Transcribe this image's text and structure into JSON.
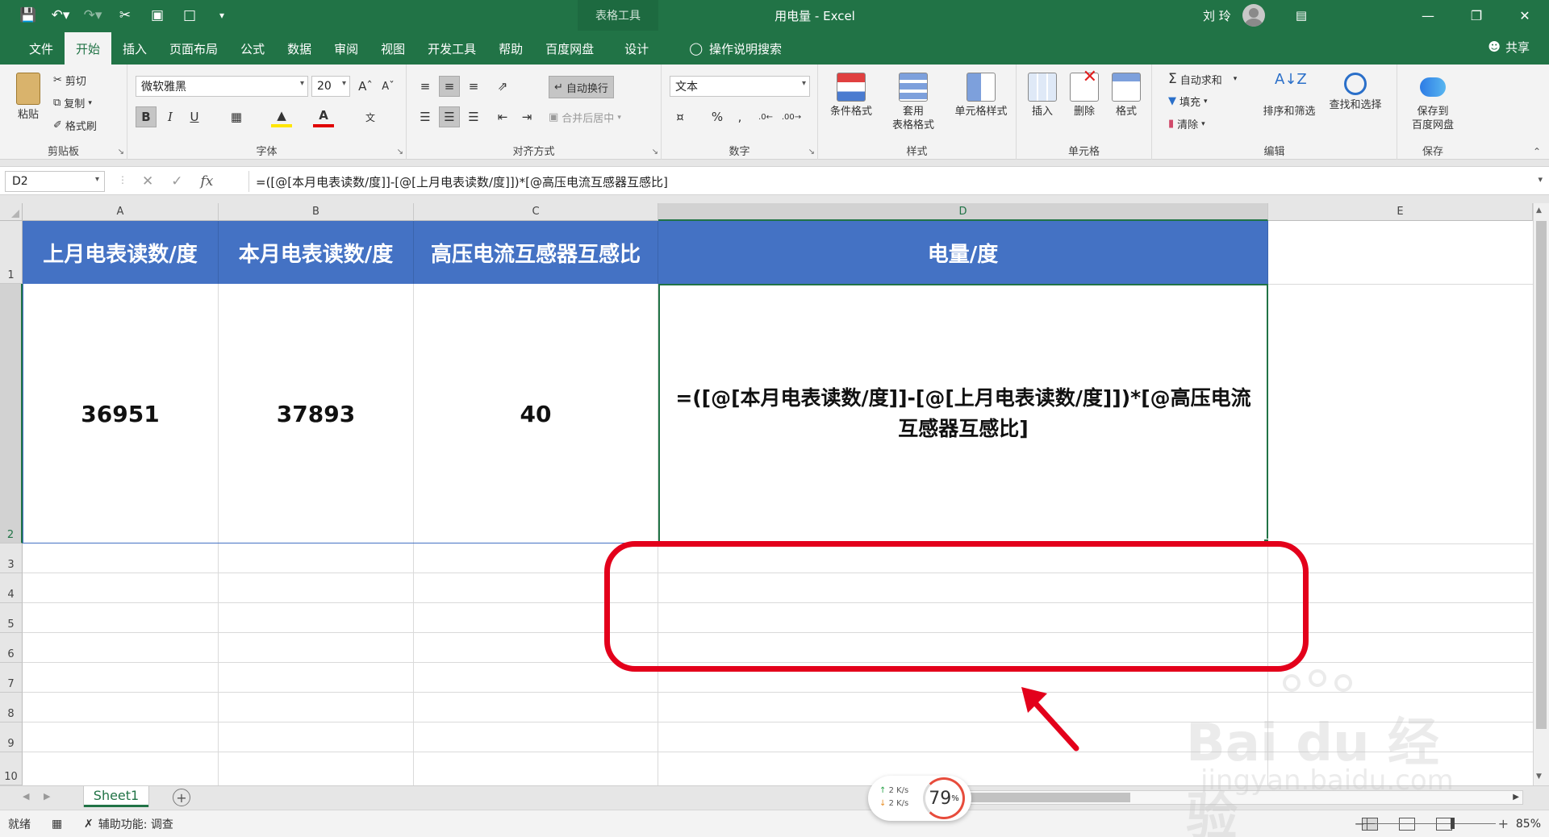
{
  "titlebar": {
    "context_tools": "表格工具",
    "doc_title": "用电量  -  Excel",
    "user_name": "刘 玲"
  },
  "tabs": [
    {
      "label": "文件"
    },
    {
      "label": "开始"
    },
    {
      "label": "插入"
    },
    {
      "label": "页面布局"
    },
    {
      "label": "公式"
    },
    {
      "label": "数据"
    },
    {
      "label": "审阅"
    },
    {
      "label": "视图"
    },
    {
      "label": "开发工具"
    },
    {
      "label": "帮助"
    },
    {
      "label": "百度网盘"
    },
    {
      "label": "设计"
    }
  ],
  "active_tab": "开始",
  "tell_me": "操作说明搜索",
  "share": "共享",
  "ribbon": {
    "clipboard": {
      "label": "剪贴板",
      "paste": "粘贴",
      "cut": "剪切",
      "copy": "复制",
      "format_painter": "格式刷"
    },
    "font": {
      "label": "字体",
      "font_name": "微软雅黑",
      "font_size": "20",
      "bold": "B",
      "italic": "I",
      "underline": "U"
    },
    "alignment": {
      "label": "对齐方式",
      "wrap_text": "自动换行",
      "merge_center": "合并后居中"
    },
    "number": {
      "label": "数字",
      "format": "文本",
      "percent": "%"
    },
    "styles": {
      "label": "样式",
      "conditional": "条件格式",
      "table_format_1": "套用",
      "table_format_2": "表格格式",
      "cell_styles": "单元格样式"
    },
    "cells": {
      "label": "单元格",
      "insert": "插入",
      "delete": "删除",
      "format": "格式"
    },
    "editing": {
      "label": "编辑",
      "autosum": "自动求和",
      "fill": "填充",
      "clear": "清除",
      "sort_filter": "排序和筛选",
      "find_select": "查找和选择"
    },
    "save": {
      "label": "保存",
      "save_to_1": "保存到",
      "save_to_2": "百度网盘"
    }
  },
  "formula_bar": {
    "name_box": "D2",
    "fx": "fx",
    "formula": "=([@[本月电表读数/度]]-[@[上月电表读数/度]])*[@高压电流互感器互感比]"
  },
  "columns": [
    "A",
    "B",
    "C",
    "D",
    "E"
  ],
  "rows": [
    "1",
    "2",
    "3",
    "4",
    "5",
    "6",
    "7",
    "8",
    "9",
    "10"
  ],
  "table": {
    "headers": [
      "上月电表读数/度",
      "本月电表读数/度",
      "高压电流互感器互感比",
      "电量/度"
    ],
    "row2": [
      "36951",
      "37893",
      "40",
      "=([@[本月电表读数/度]]-[@[上月电表读数/度]])*[@高压电流互感器互感比]"
    ]
  },
  "sheet_tab": "Sheet1",
  "status": {
    "ready": "就绪",
    "accessibility": "辅助功能: 调查",
    "zoom": "85%"
  },
  "network_widget": {
    "up": "2  K/s",
    "down": "2  K/s",
    "percent": "79",
    "percent_sign": "%"
  },
  "watermark": {
    "brand": "Bai  du 经验",
    "url": "jingyan.baidu.com"
  },
  "colors": {
    "excel_green": "#217346",
    "header_blue": "#4472c4",
    "annotation_red": "#e3001b"
  }
}
